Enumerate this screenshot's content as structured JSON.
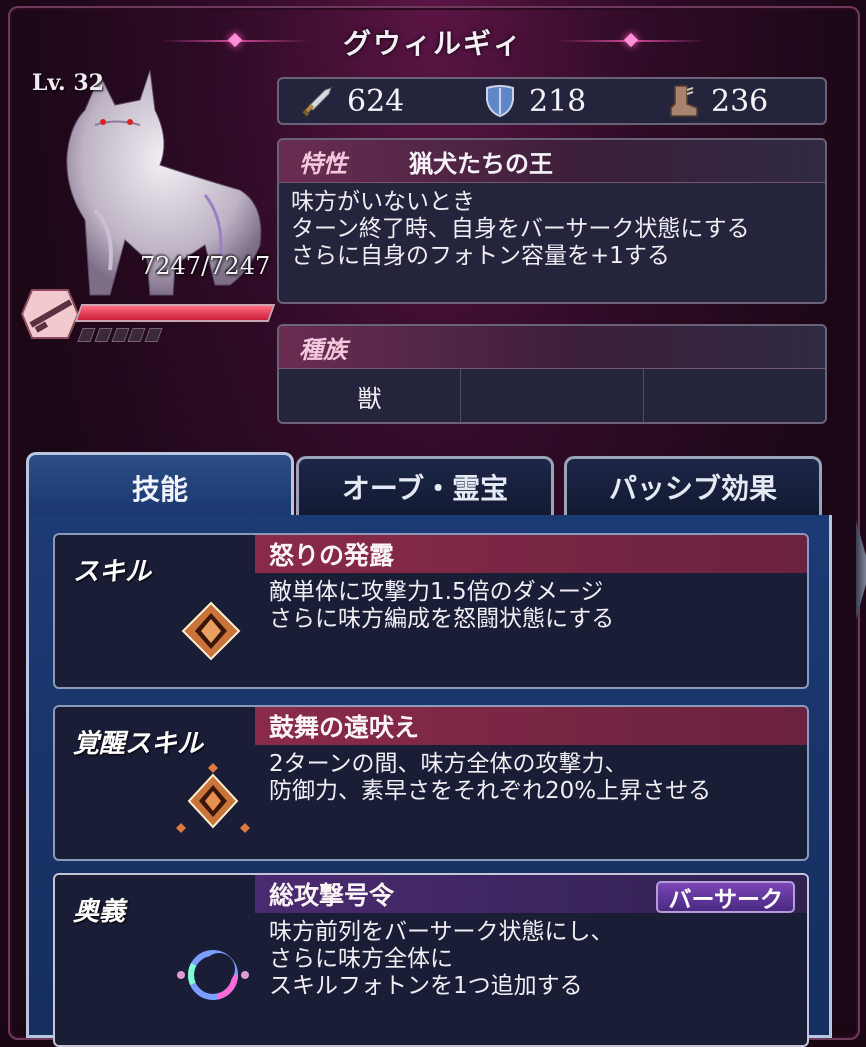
{
  "character": {
    "name": "グウィルギィ",
    "level": "Lv. 32",
    "hp": "7247/7247"
  },
  "stats": {
    "attack": "624",
    "defense": "218",
    "speed": "236"
  },
  "trait": {
    "label": "特性",
    "name": "猟犬たちの王",
    "lines": [
      "味方がいないとき",
      "ターン終了時、自身をバーサーク状態にする",
      "さらに自身のフォトン容量を+1する"
    ]
  },
  "race": {
    "label": "種族",
    "values": [
      "獣",
      "",
      ""
    ]
  },
  "tabs": [
    "技能",
    "オーブ・霊宝",
    "パッシブ効果"
  ],
  "skills": [
    {
      "type": "スキル",
      "name": "怒りの発露",
      "lines": [
        "敵単体に攻撃力1.5倍のダメージ",
        "さらに味方編成を怒闘状態にする"
      ]
    },
    {
      "type": "覚醒スキル",
      "name": "鼓舞の遠吠え",
      "lines": [
        "2ターンの間、味方全体の攻撃力、",
        "防御力、素早さをそれぞれ20%上昇させる"
      ]
    },
    {
      "type": "奥義",
      "name": "総攻撃号令",
      "badge": "バーサーク",
      "lines": [
        "味方前列をバーサーク状態にし、",
        "さらに味方全体に",
        "スキルフォトンを1つ追加する"
      ]
    }
  ]
}
